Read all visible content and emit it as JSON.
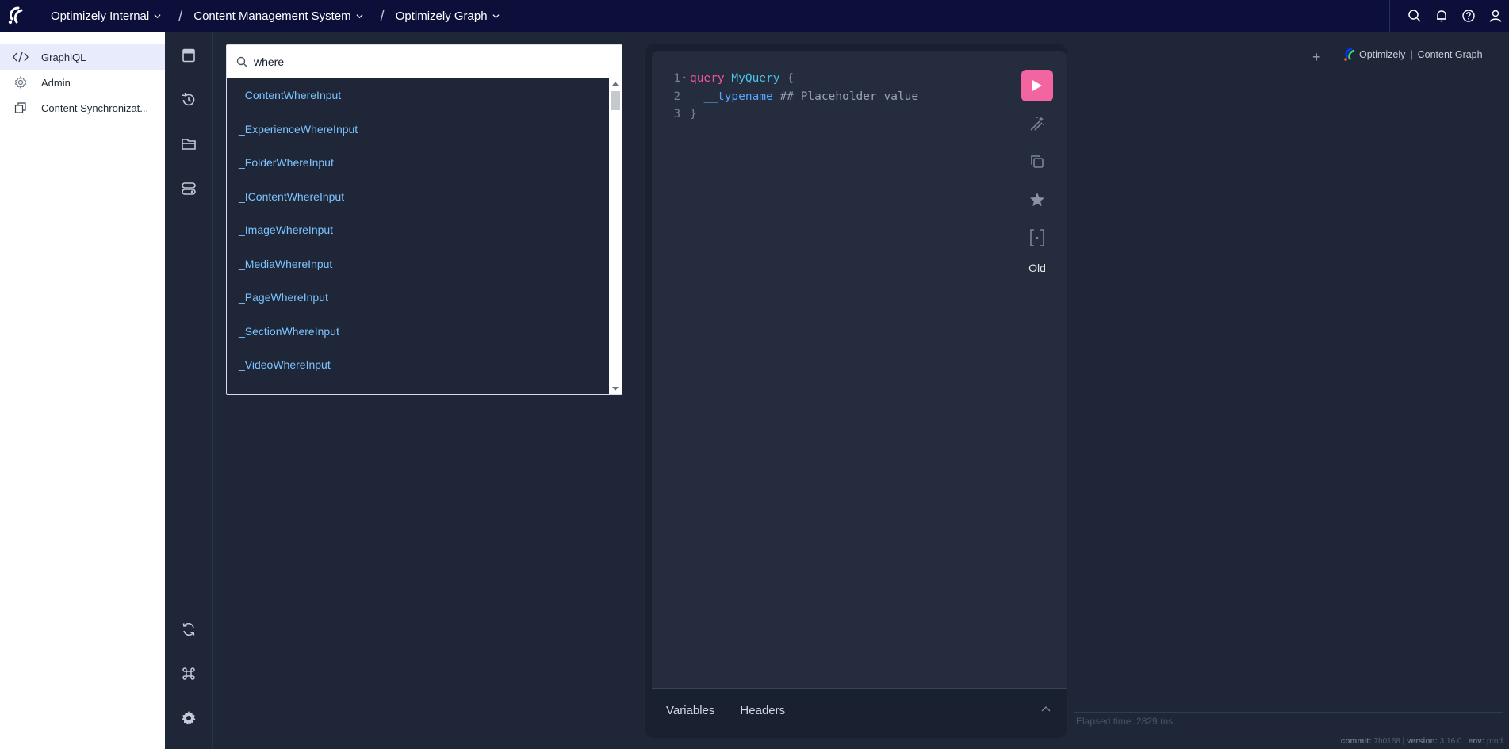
{
  "topbar": {
    "org": "Optimizely Internal",
    "product": "Content Management System",
    "service": "Optimizely Graph"
  },
  "leftnav": {
    "items": [
      {
        "label": "GraphiQL",
        "icon": "code-icon",
        "active": true
      },
      {
        "label": "Admin",
        "icon": "gear-icon",
        "active": false
      },
      {
        "label": "Content Synchronizat...",
        "icon": "sync-copy-icon",
        "active": false
      }
    ]
  },
  "search": {
    "value": "where",
    "results": [
      "_ContentWhereInput",
      "_ExperienceWhereInput",
      "_FolderWhereInput",
      "_IContentWhereInput",
      "_ImageWhereInput",
      "_MediaWhereInput",
      "_PageWhereInput",
      "_SectionWhereInput",
      "_VideoWhereInput"
    ]
  },
  "editor": {
    "line1_no": "1",
    "line2_no": "2",
    "line3_no": "3",
    "keyword": "query",
    "op_name": "MyQuery",
    "open_brace": "{",
    "field": "__typename",
    "comment": "## Placeholder value",
    "close_brace": "}",
    "old_label": "Old",
    "tab_variables": "Variables",
    "tab_headers": "Headers"
  },
  "result_pane": {
    "brand_name": "Optimizely",
    "brand_product": "Content Graph",
    "elapsed": "Elapsed time: 2829 ms",
    "commit_label": "commit:",
    "commit_value": "7b0168",
    "version_label": "version:",
    "version_value": "3.16.0",
    "env_label": "env:",
    "env_value": "prod"
  },
  "colors": {
    "topbar_bg": "#0b0f3a",
    "run_button": "#f265a0",
    "link_blue": "#7cc4ff",
    "keyword_pink": "#f0569a"
  }
}
